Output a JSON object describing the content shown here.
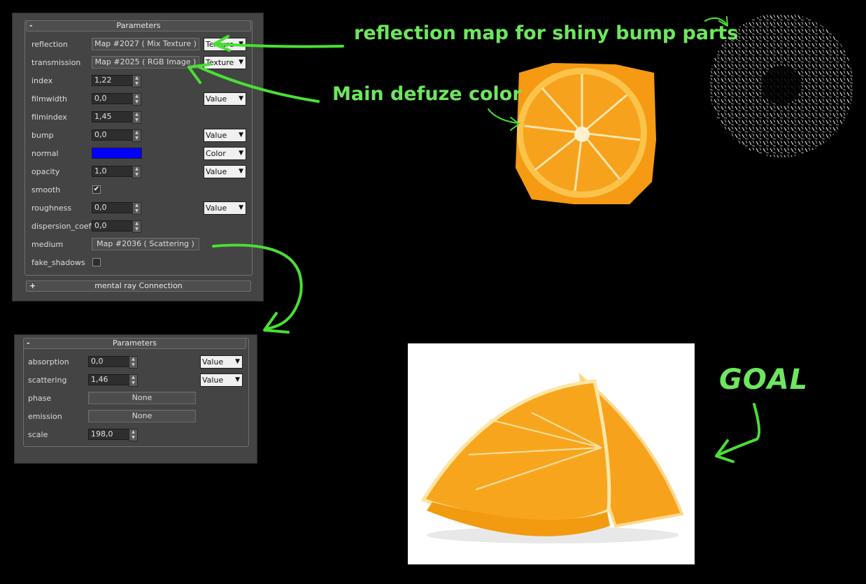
{
  "panel1": {
    "header": {
      "sign": "-",
      "title": "Parameters"
    },
    "rows": {
      "reflection": {
        "label": "reflection",
        "map": "Map #2027  ( Mix Texture )",
        "dropdown": "Texture"
      },
      "transmission": {
        "label": "transmission",
        "map": "Map #2025  ( RGB Image )",
        "dropdown": "Texture"
      },
      "index": {
        "label": "index",
        "value": "1,22"
      },
      "filmwidth": {
        "label": "filmwidth",
        "value": "0,0",
        "dropdown": "Value"
      },
      "filmindex": {
        "label": "filmindex",
        "value": "1,45"
      },
      "bump": {
        "label": "bump",
        "value": "0,0",
        "dropdown": "Value"
      },
      "normal": {
        "label": "normal",
        "color": "#0000ff",
        "dropdown": "Color"
      },
      "opacity": {
        "label": "opacity",
        "value": "1,0",
        "dropdown": "Value"
      },
      "smooth": {
        "label": "smooth",
        "checked": true
      },
      "roughness": {
        "label": "roughness",
        "value": "0,0",
        "dropdown": "Value"
      },
      "dispersion": {
        "label": "dispersion_coeffic",
        "value": "0,0"
      },
      "medium": {
        "label": "medium",
        "map": "Map #2036  ( Scattering )"
      },
      "fake_shadows": {
        "label": "fake_shadows",
        "checked": false
      }
    },
    "footer": {
      "sign": "+",
      "title": "mental ray Connection"
    }
  },
  "panel2": {
    "header": {
      "sign": "-",
      "title": "Parameters"
    },
    "rows": {
      "absorption": {
        "label": "absorption",
        "value": "0,0",
        "dropdown": "Value"
      },
      "scattering": {
        "label": "scattering",
        "value": "1,46",
        "dropdown": "Value"
      },
      "phase": {
        "label": "phase",
        "map": "None"
      },
      "emission": {
        "label": "emission",
        "map": "None"
      },
      "scale": {
        "label": "scale",
        "value": "198,0"
      }
    }
  },
  "annotations": {
    "reflection_note": "reflection map for shiny bump parts",
    "diffuse_note": "Main defuze color",
    "goal_note": "GOAL"
  },
  "colors": {
    "annotation_green": "#6ee65e",
    "panel_bg": "#444444",
    "orange": "#f7a21c"
  }
}
